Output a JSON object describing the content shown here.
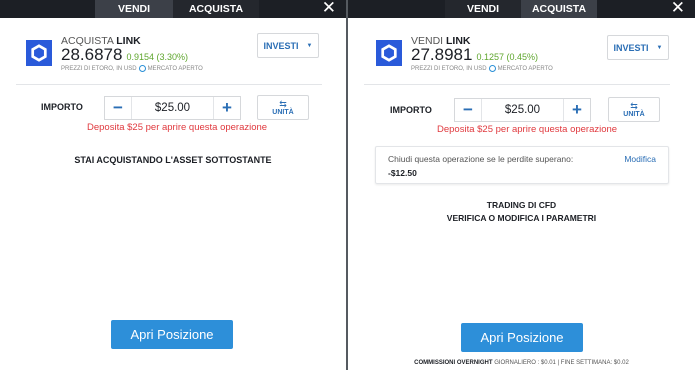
{
  "left": {
    "tabs": [
      "VENDI",
      "ACQUISTA"
    ],
    "action": "ACQUISTA",
    "symbol": "LINK",
    "price": "28.6878",
    "change": "0.9154 (3.30%)",
    "price_note": "PREZZI DI ETORO, IN USD",
    "market_status": "MERCATO APERTO",
    "invest_label": "INVESTI",
    "amount_label": "IMPORTO",
    "amount_value": "$25.00",
    "units_label": "UNITÀ",
    "warning": "Deposita $25 per aprire questa operazione",
    "info_text": "STAI ACQUISTANDO L'ASSET SOTTOSTANTE",
    "open_button": "Apri Posizione"
  },
  "right": {
    "tabs": [
      "VENDI",
      "ACQUISTA"
    ],
    "action": "VENDI",
    "symbol": "LINK",
    "price": "27.8981",
    "change": "0.1257 (0.45%)",
    "price_note": "PREZZI DI ETORO, IN USD",
    "market_status": "MERCATO APERTO",
    "invest_label": "INVESTI",
    "amount_label": "IMPORTO",
    "amount_value": "$25.00",
    "units_label": "UNITÀ",
    "warning": "Deposita $25 per aprire questa operazione",
    "stop_loss": {
      "label": "Chiudi questa operazione se le perdite superano:",
      "value": "-$12.50",
      "edit_label": "Modifica"
    },
    "cfd_line1": "TRADING DI CFD",
    "cfd_line2": "VERIFICA O MODIFICA I PARAMETRI",
    "open_button": "Apri Posizione",
    "overnight": {
      "title": "COMMISSIONI OVERNIGHT",
      "daily": "GIORNALIERO : $0.01",
      "weekend": "FINE SETTIMANA: $0.02"
    }
  },
  "colors": {
    "topbar": "#1c1f25",
    "accent_blue": "#2d8fd9",
    "chainlink_blue": "#2a5ada",
    "positive": "#5fa62e",
    "warning": "#e0393e"
  }
}
